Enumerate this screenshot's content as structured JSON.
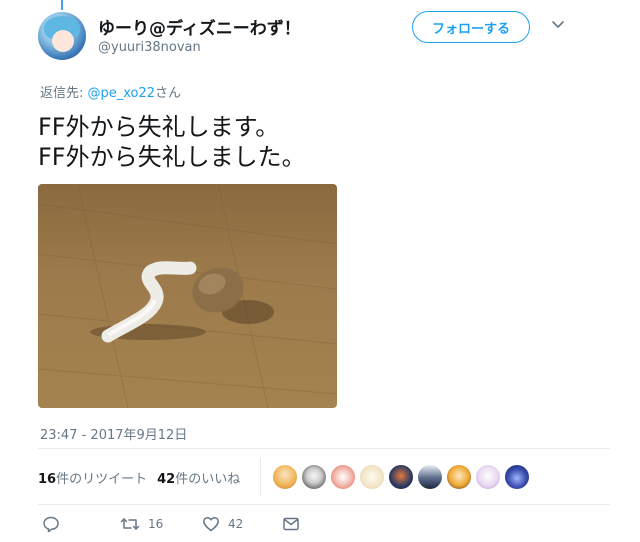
{
  "user": {
    "display_name": "ゆーり@ディズニーわず！",
    "handle": "@yuuri38novan"
  },
  "follow_button": {
    "label": "フォローする"
  },
  "reply": {
    "prefix": "返信先: ",
    "mention": "@pe_xo22",
    "suffix": "さん"
  },
  "tweet": {
    "lines": [
      "FF外から失礼します。",
      "FF外から失礼しました。"
    ]
  },
  "timestamp": "23:47 - 2017年9月12日",
  "stats": {
    "retweets_count": "16",
    "retweets_label": "件のリツイート",
    "likes_count": "42",
    "likes_label": "件のいいね"
  },
  "actions": {
    "retweet_count": "16",
    "like_count": "42"
  },
  "colors": {
    "accent": "#1da1f2",
    "muted": "#657786",
    "text": "#14171a"
  }
}
